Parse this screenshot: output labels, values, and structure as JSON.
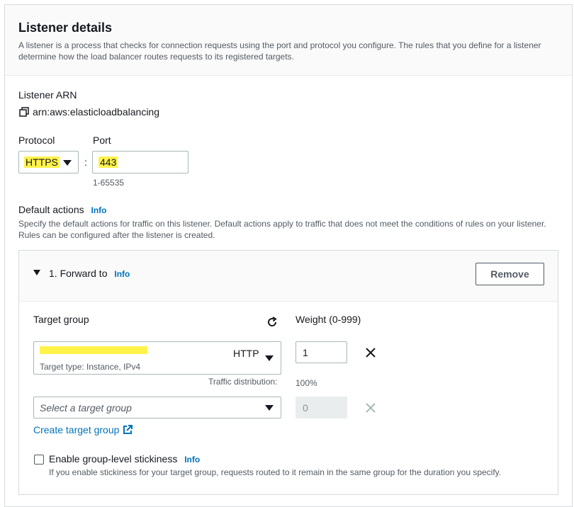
{
  "header": {
    "title": "Listener details",
    "description": "A listener is a process that checks for connection requests using the port and protocol you configure. The rules that you define for a listener determine how the load balancer routes requests to its registered targets."
  },
  "arn": {
    "label": "Listener ARN",
    "value": "arn:aws:elasticloadbalancing"
  },
  "protocol": {
    "label": "Protocol",
    "value": "HTTPS"
  },
  "port": {
    "label": "Port",
    "value": "443",
    "hint": "1-65535",
    "separator": ":"
  },
  "default_actions": {
    "label": "Default actions",
    "info": "Info",
    "description": "Specify the default actions for traffic on this listener. Default actions apply to traffic that does not meet the conditions of rules on your listener. Rules can be configured after the listener is created."
  },
  "action": {
    "title": "1. Forward to",
    "info": "Info",
    "remove_label": "Remove",
    "target_group_label": "Target group",
    "weight_label": "Weight (0-999)",
    "group1": {
      "protocol": "HTTP",
      "type": "Target type: Instance, IPv4",
      "weight": "1"
    },
    "traffic_label": "Traffic distribution:",
    "traffic_value": "100%",
    "group2": {
      "placeholder": "Select a target group",
      "weight": "0"
    },
    "create_link": "Create target group",
    "stickiness_label": "Enable group-level stickiness",
    "stickiness_info": "Info",
    "stickiness_desc": "If you enable stickiness for your target group, requests routed to it remain in the same group for the duration you specify."
  }
}
